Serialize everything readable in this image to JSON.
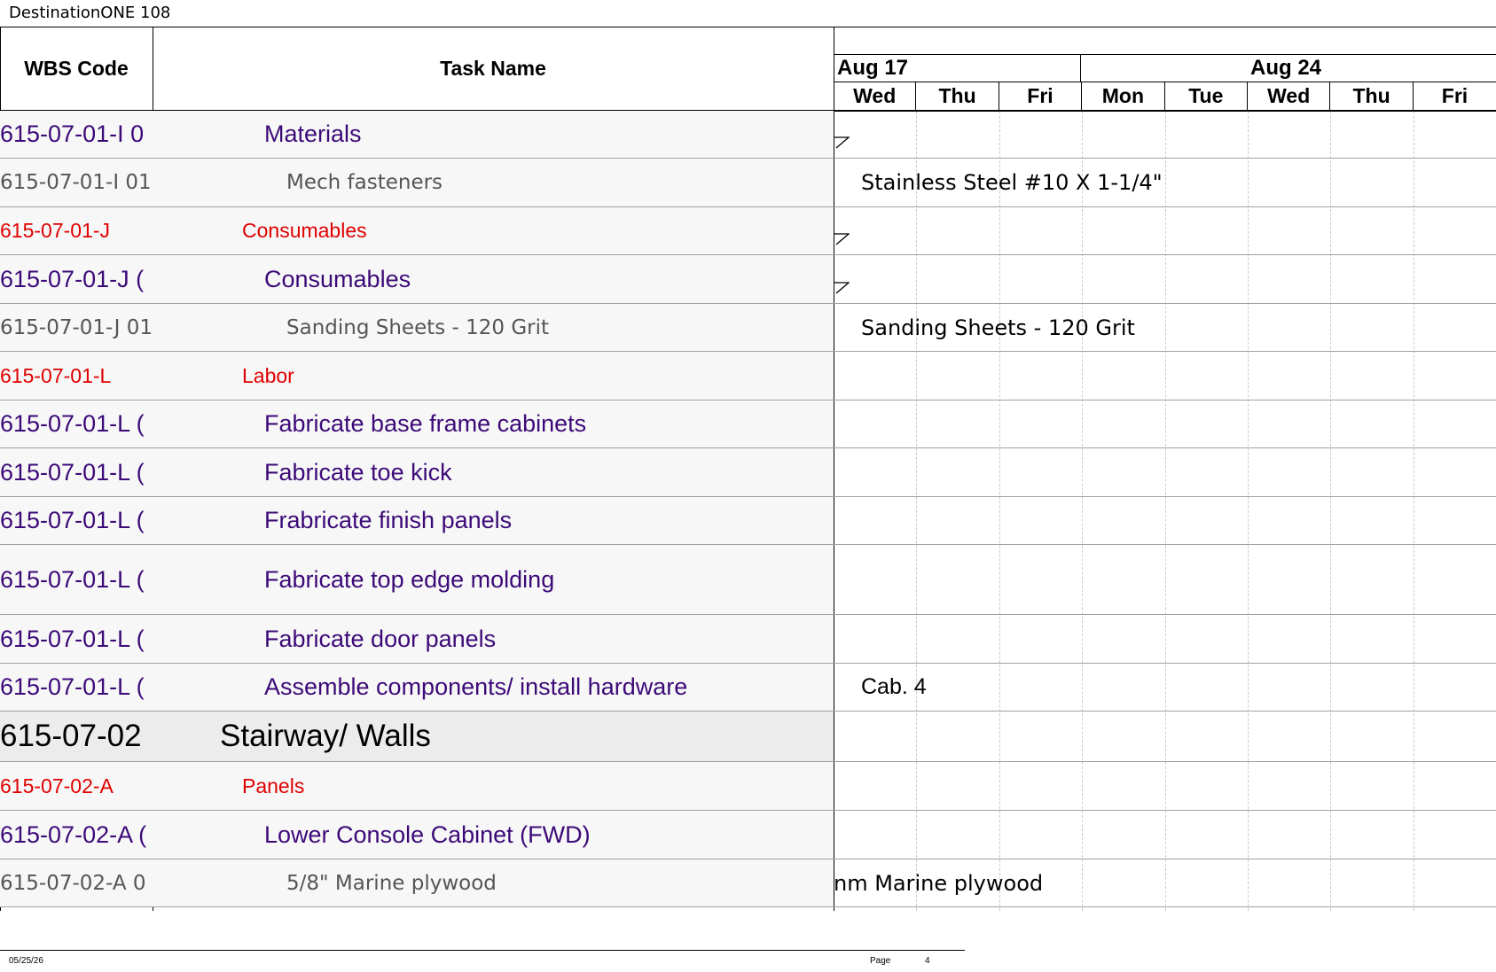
{
  "document": {
    "title": "DestinationONE 108"
  },
  "header": {
    "wbs_label": "WBS Code",
    "task_label": "Task Name",
    "weeks": [
      "Aug 17",
      "Aug 24"
    ],
    "days": [
      "Wed",
      "Thu",
      "Fri",
      "Mon",
      "Tue",
      "Wed",
      "Thu",
      "Fri"
    ]
  },
  "rows": [
    {
      "wbs": "615-07-01-I 0",
      "task": "Materials",
      "style": "purple",
      "note": ""
    },
    {
      "wbs": "615-07-01-I 01",
      "task": "Mech fasteners",
      "style": "gray",
      "note": "Stainless Steel #10 X 1-1/4\""
    },
    {
      "wbs": "615-07-01-J",
      "task": "Consumables",
      "style": "red",
      "note": ""
    },
    {
      "wbs": "615-07-01-J (",
      "task": "Consumables",
      "style": "purple",
      "note": ""
    },
    {
      "wbs": "615-07-01-J 01",
      "task": "Sanding Sheets - 120 Grit",
      "style": "gray",
      "note": "Sanding Sheets - 120 Grit"
    },
    {
      "wbs": "615-07-01-L",
      "task": "Labor",
      "style": "red",
      "note": ""
    },
    {
      "wbs": "615-07-01-L (",
      "task": "Fabricate base frame cabinets",
      "style": "purple",
      "note": ""
    },
    {
      "wbs": "615-07-01-L (",
      "task": "Fabricate toe kick",
      "style": "purple",
      "note": ""
    },
    {
      "wbs": "615-07-01-L (",
      "task": "Frabricate finish panels",
      "style": "purple",
      "note": ""
    },
    {
      "wbs": "615-07-01-L (",
      "task": "Fabricate top edge molding",
      "style": "purple",
      "note": ""
    },
    {
      "wbs": "615-07-01-L (",
      "task": "Fabricate door panels",
      "style": "purple",
      "note": ""
    },
    {
      "wbs": "615-07-01-L (",
      "task": "Assemble components/ install hardware",
      "style": "purple",
      "note": "Cab. 4"
    },
    {
      "wbs": "615-07-02",
      "task": "Stairway/ Walls",
      "style": "summary",
      "note": ""
    },
    {
      "wbs": "615-07-02-A",
      "task": "Panels",
      "style": "red",
      "note": ""
    },
    {
      "wbs": "615-07-02-A (",
      "task": "Lower Console Cabinet (FWD)",
      "style": "purple",
      "note": ""
    },
    {
      "wbs": "615-07-02-A 0",
      "task": "5/8\" Marine plywood",
      "style": "gray",
      "note": "nm Marine plywood"
    }
  ],
  "footer": {
    "date": "05/25/26",
    "page_label": "Page",
    "page_number": "4"
  }
}
